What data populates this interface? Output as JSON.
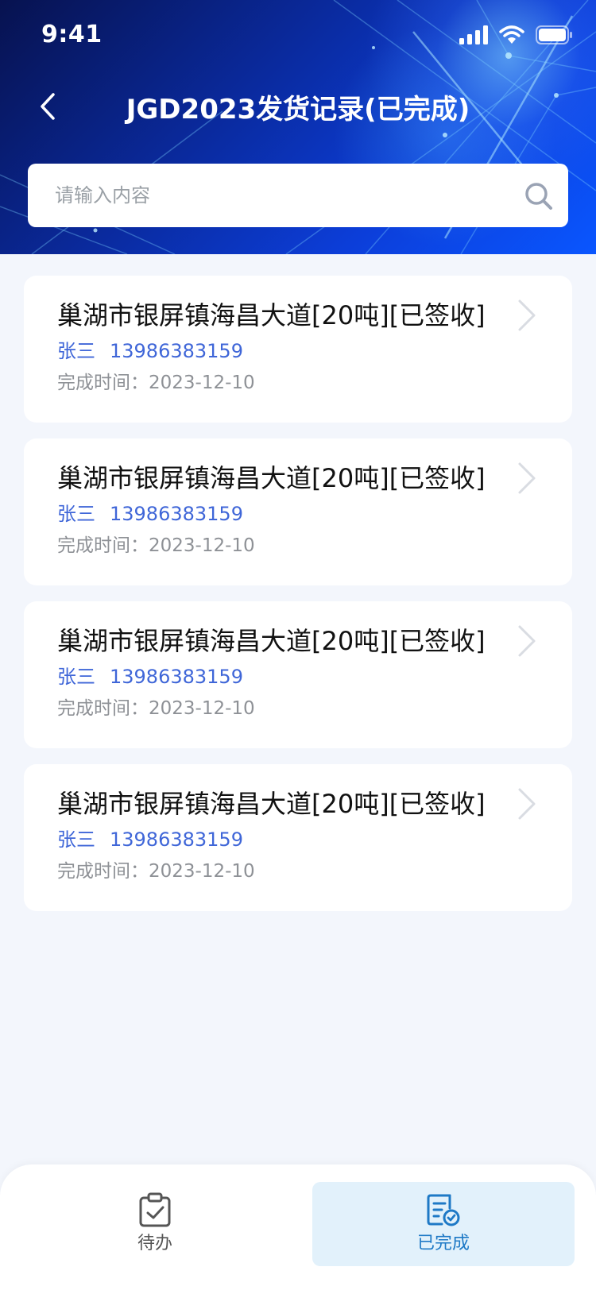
{
  "status_bar": {
    "time": "9:41"
  },
  "nav": {
    "title": "JGD2023发货记录(已完成)"
  },
  "search": {
    "placeholder": "请输入内容",
    "value": ""
  },
  "records": [
    {
      "title": "巢湖市银屏镇海昌大道[20吨][已签收]",
      "name": "张三",
      "phone": "13986383159",
      "time_label": "完成时间：",
      "time_value": "2023-12-10"
    },
    {
      "title": "巢湖市银屏镇海昌大道[20吨][已签收]",
      "name": "张三",
      "phone": "13986383159",
      "time_label": "完成时间：",
      "time_value": "2023-12-10"
    },
    {
      "title": "巢湖市银屏镇海昌大道[20吨][已签收]",
      "name": "张三",
      "phone": "13986383159",
      "time_label": "完成时间：",
      "time_value": "2023-12-10"
    },
    {
      "title": "巢湖市银屏镇海昌大道[20吨][已签收]",
      "name": "张三",
      "phone": "13986383159",
      "time_label": "完成时间：",
      "time_value": "2023-12-10"
    }
  ],
  "tabs": [
    {
      "label": "待办",
      "icon": "clipboard-check-icon",
      "active": false
    },
    {
      "label": "已完成",
      "icon": "document-check-icon",
      "active": true
    }
  ],
  "colors": {
    "accent": "#1e79c6",
    "contact": "#3f66d8",
    "active_tab_bg": "#e2f1fb",
    "page_bg": "#f3f6fc"
  }
}
